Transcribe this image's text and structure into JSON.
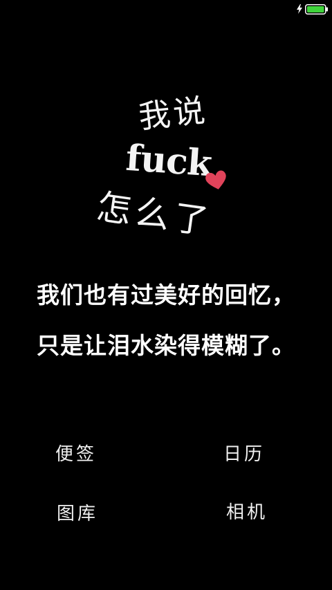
{
  "status_bar": {
    "charging_icon": "lightning-bolt",
    "battery_icon": "battery-full",
    "battery_color": "#3fd43b"
  },
  "wallpaper": {
    "line1": "我说",
    "line2": "fuck",
    "line3": "怎么了",
    "heart_color": "#e0435a"
  },
  "poem": {
    "line1": "我们也有过美好的回忆，",
    "line2": "只是让泪水染得模糊了。"
  },
  "shortcuts": {
    "notes": "便签",
    "calendar": "日历",
    "gallery": "图库",
    "camera": "相机"
  }
}
